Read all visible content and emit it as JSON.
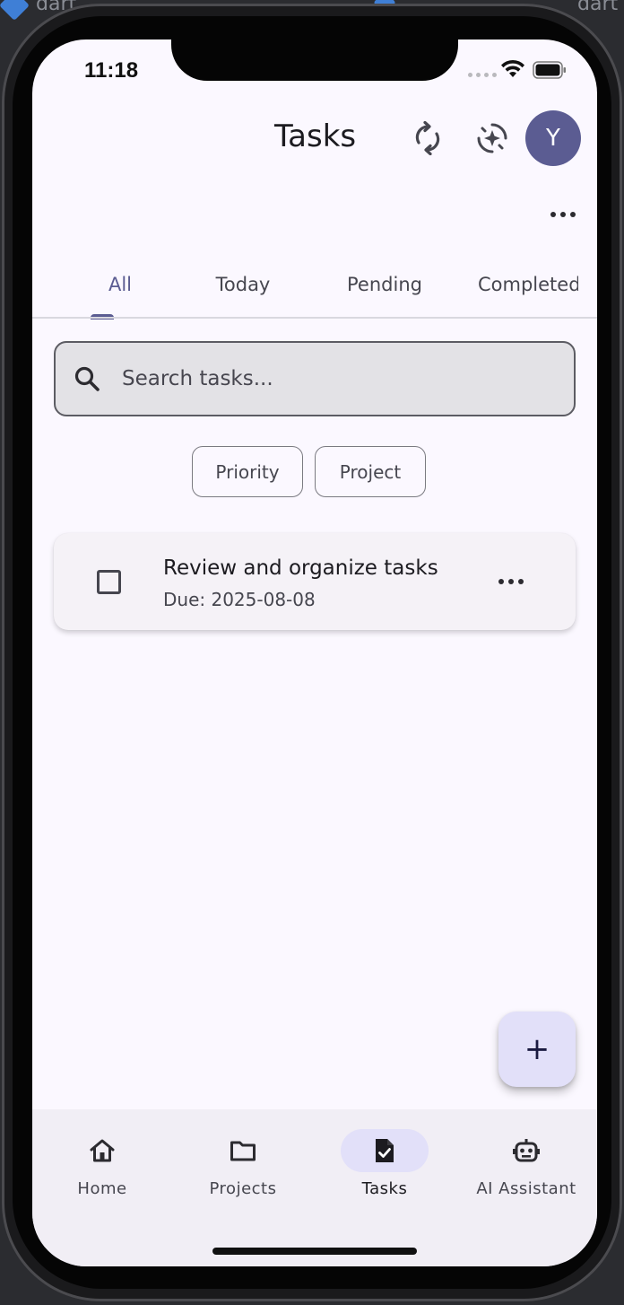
{
  "background_window": {
    "left_text": "dart",
    "right_text": "dart"
  },
  "status_bar": {
    "time": "11:18"
  },
  "app_bar": {
    "title": "Tasks",
    "avatar_initial": "Y",
    "icons": [
      "sync-icon",
      "ai-sparkle-icon",
      "more-horizontal-icon"
    ]
  },
  "tabs": {
    "items": [
      "All",
      "Today",
      "Pending",
      "Completed"
    ],
    "selected": "All"
  },
  "search": {
    "placeholder": "Search tasks..."
  },
  "filters": {
    "priority_label": "Priority",
    "project_label": "Project"
  },
  "tasks": [
    {
      "title": "Review and organize tasks",
      "due": "Due: 2025-08-08",
      "checked": false
    }
  ],
  "fab": {
    "label": "+"
  },
  "bottom_nav": {
    "items": [
      {
        "label": "Home",
        "icon": "home-icon"
      },
      {
        "label": "Projects",
        "icon": "folder-icon"
      },
      {
        "label": "Tasks",
        "icon": "task-check-icon"
      },
      {
        "label": "AI Assistant",
        "icon": "robot-icon"
      }
    ],
    "selected": "Tasks"
  },
  "colors": {
    "primary": "#5b5c92",
    "surface": "#fbf8ff",
    "nav_background": "#f1eef5",
    "selected_pill": "#e2e0f9"
  }
}
